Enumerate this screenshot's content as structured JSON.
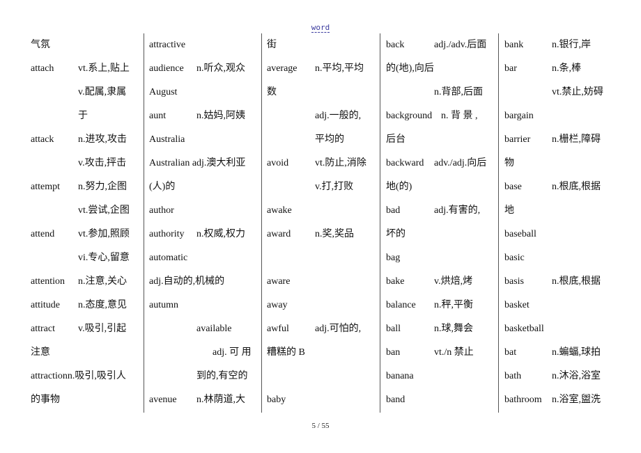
{
  "header": {
    "title": "word"
  },
  "footer": {
    "page": "5 / 55"
  },
  "columns": [
    {
      "rows": [
        {
          "w": "气氛",
          "d": ""
        },
        {
          "w": "attach",
          "d": "vt.系上,贴上"
        },
        {
          "w": "",
          "d": "v.配属,隶属"
        },
        {
          "w": "",
          "d": "于"
        },
        {
          "w": "attack",
          "d": "n.进攻,攻击"
        },
        {
          "w": "",
          "d": "v.攻击,抨击"
        },
        {
          "w": "attempt",
          "d": "n.努力,企图"
        },
        {
          "w": "",
          "d": "vt.尝试,企图"
        },
        {
          "w": "attend",
          "d": "vt.参加,照顾"
        },
        {
          "w": "",
          "d": "vi.专心,留意"
        },
        {
          "w": "attention",
          "d": "n.注意,关心"
        },
        {
          "w": "attitude",
          "d": "n.态度,意见"
        },
        {
          "w": "attract",
          "d": "v.吸引,引起"
        },
        {
          "w": "注意",
          "d": ""
        },
        {
          "w": "attractionn.吸引,吸引人",
          "d": ""
        },
        {
          "w": "的事物",
          "d": ""
        }
      ]
    },
    {
      "rows": [
        {
          "w": "attractive",
          "d": ""
        },
        {
          "w": "audience",
          "d": "n.听众,观众"
        },
        {
          "w": "August",
          "d": ""
        },
        {
          "w": "aunt",
          "d": "n.姑妈,阿姨"
        },
        {
          "w": "Australia",
          "d": ""
        },
        {
          "w": "Australian adj.澳大利亚",
          "d": ""
        },
        {
          "w": "(人)的",
          "d": ""
        },
        {
          "w": "author",
          "d": ""
        },
        {
          "w": "authority",
          "d": "n.权威,权力"
        },
        {
          "w": "automatic",
          "d": ""
        },
        {
          "w": "adj.自动的,机械的",
          "d": ""
        },
        {
          "w": "autumn",
          "d": ""
        },
        {
          "w": "",
          "d": "available"
        },
        {
          "w": "",
          "d": "adj. 可 用",
          "indent": true
        },
        {
          "w": "",
          "d": "到的,有空的"
        },
        {
          "w": "avenue",
          "d": "n.林荫道,大"
        }
      ]
    },
    {
      "rows": [
        {
          "w": "街",
          "d": ""
        },
        {
          "w": "average",
          "d": "n.平均,平均"
        },
        {
          "w": "数",
          "d": ""
        },
        {
          "w": "",
          "d": "adj.一般的,"
        },
        {
          "w": "",
          "d": "平均的"
        },
        {
          "w": "avoid",
          "d": "vt.防止,消除"
        },
        {
          "w": "",
          "d": "v.打,打败"
        },
        {
          "w": "awake",
          "d": ""
        },
        {
          "w": "award",
          "d": "n.奖,奖品"
        },
        {
          "w": "",
          "d": ""
        },
        {
          "w": "aware",
          "d": ""
        },
        {
          "w": "away",
          "d": ""
        },
        {
          "w": "awful",
          "d": "adj.可怕的,"
        },
        {
          "w": "糟糕的 B",
          "d": ""
        },
        {
          "w": "",
          "d": ""
        },
        {
          "w": "baby",
          "d": ""
        }
      ]
    },
    {
      "rows": [
        {
          "w": "back",
          "d": "adj./adv.后面"
        },
        {
          "w": "的(地),向后",
          "d": ""
        },
        {
          "w": "",
          "d": "n.背部,后面"
        },
        {
          "w": "background",
          "d": "n. 背 景 ,",
          "far": true
        },
        {
          "w": "后台",
          "d": ""
        },
        {
          "w": "backward",
          "d": "adv./adj.向后"
        },
        {
          "w": "地(的)",
          "d": ""
        },
        {
          "w": "bad",
          "d": "adj.有害的,"
        },
        {
          "w": "坏的",
          "d": ""
        },
        {
          "w": "bag",
          "d": ""
        },
        {
          "w": "bake",
          "d": "v.烘焙,烤"
        },
        {
          "w": "balance",
          "d": "n.秤,平衡"
        },
        {
          "w": "ball",
          "d": "n.球,舞会"
        },
        {
          "w": "ban",
          "d": "vt./n 禁止"
        },
        {
          "w": "banana",
          "d": ""
        },
        {
          "w": "band",
          "d": ""
        }
      ]
    },
    {
      "rows": [
        {
          "w": "bank",
          "d": "n.银行,岸"
        },
        {
          "w": "bar",
          "d": "n.条,棒"
        },
        {
          "w": "",
          "d": "vt.禁止,妨碍"
        },
        {
          "w": "bargain",
          "d": ""
        },
        {
          "w": "barrier",
          "d": "n.栅栏,障碍"
        },
        {
          "w": "物",
          "d": ""
        },
        {
          "w": "base",
          "d": "n.根底,根据"
        },
        {
          "w": "地",
          "d": ""
        },
        {
          "w": "baseball",
          "d": ""
        },
        {
          "w": "basic",
          "d": ""
        },
        {
          "w": "basis",
          "d": "n.根底,根据"
        },
        {
          "w": "basket",
          "d": ""
        },
        {
          "w": "basketball",
          "d": ""
        },
        {
          "w": "bat",
          "d": "n.蝙蝠,球拍"
        },
        {
          "w": "bath",
          "d": "n.沐浴,浴室"
        },
        {
          "w": "bathroom",
          "d": "n.浴室,盥洗"
        }
      ]
    }
  ]
}
